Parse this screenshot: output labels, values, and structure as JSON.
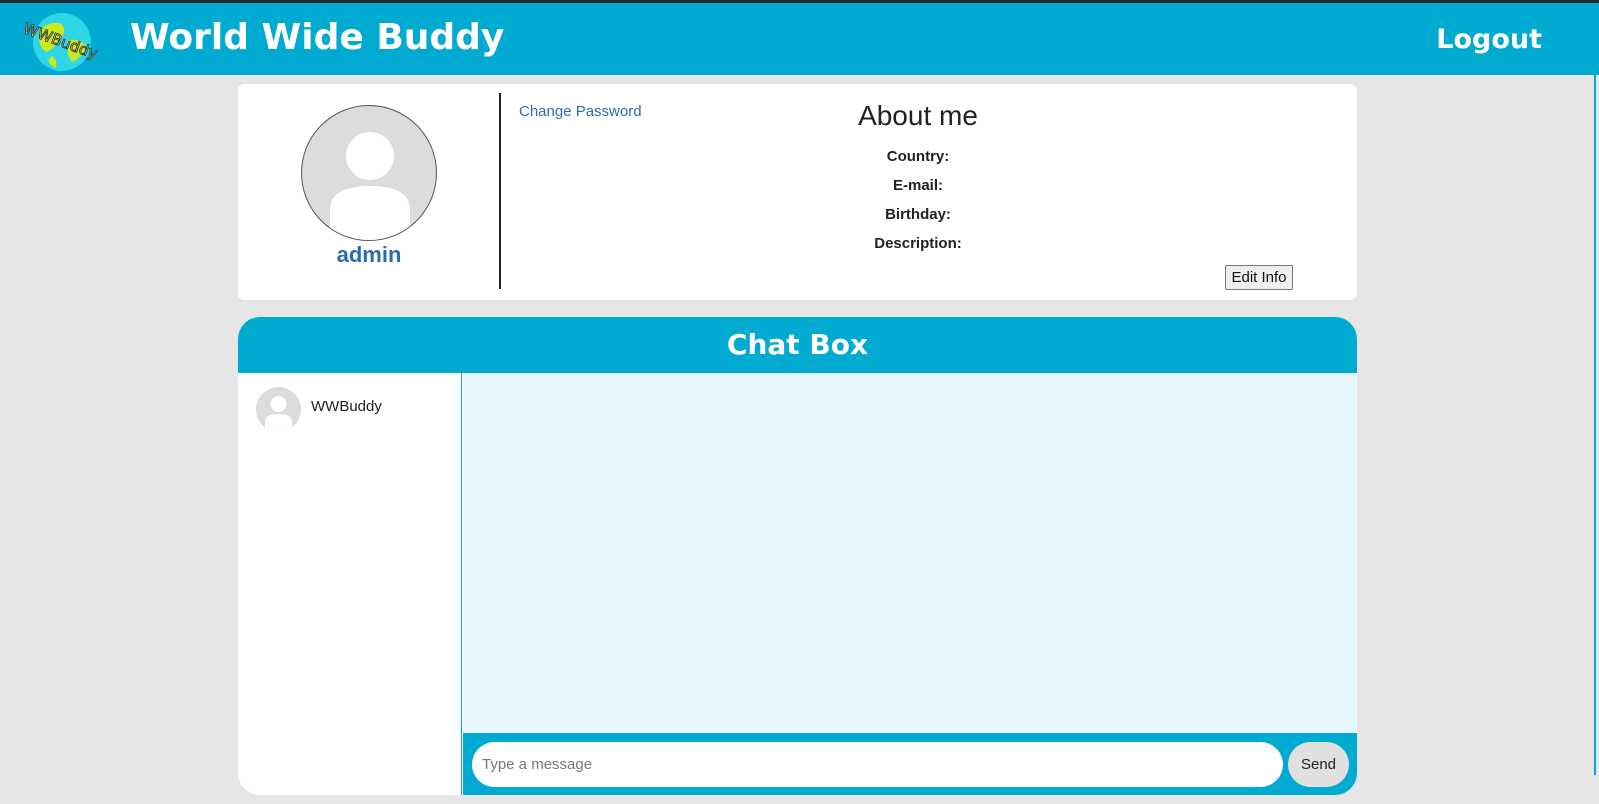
{
  "header": {
    "logo_text": "WWBuddy",
    "title": "World Wide Buddy",
    "logout_label": "Logout"
  },
  "profile": {
    "username": "admin",
    "change_password_label": "Change Password",
    "about_title": "About me",
    "fields": {
      "country_label": "Country:",
      "email_label": "E-mail:",
      "birthday_label": "Birthday:",
      "description_label": "Description:"
    },
    "edit_button_label": "Edit Info"
  },
  "chat": {
    "title": "Chat Box",
    "contacts": [
      {
        "name": "WWBuddy"
      }
    ],
    "input_placeholder": "Type a message",
    "send_label": "Send"
  },
  "colors": {
    "brand": "#00aad0",
    "link": "#2d6bb1",
    "chat_background": "#e8f7fd",
    "page_background": "#e6e6e6"
  }
}
